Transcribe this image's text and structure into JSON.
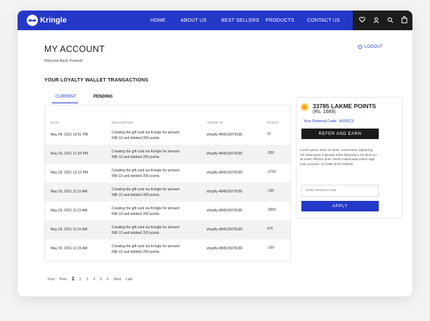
{
  "header": {
    "brand": "Kringle",
    "nav": [
      "HOME",
      "ABOUT US",
      "BEST SELLERS",
      "PRODUCTS",
      "CONTACT US"
    ],
    "icons": [
      "heart-icon",
      "user-icon",
      "search-icon",
      "bag-icon"
    ]
  },
  "account": {
    "title": "MY ACCOUNT",
    "welcome": "Welcome Back, Pramod!",
    "logout": "LOGOUT"
  },
  "wallet": {
    "section_title": "YOUR LOYALTY WALLET TRANSACTIONS",
    "tabs": [
      "CURRENT",
      "PENDING"
    ],
    "columns": [
      "DATE",
      "DESCRIPTION",
      "ORDER ID",
      "POINTS"
    ],
    "rows": [
      {
        "date": "May 04, 2021 16:51 PM",
        "desc1": "Creating the gift card via Kringle for amount",
        "desc2": "INR 10 and debited 200 points.",
        "order": "shopify-484615979180",
        "points": "10"
      },
      {
        "date": "May 03, 2021 21:29 PM",
        "desc1": "Creating the gift card via Kringle for amount",
        "desc2": "INR 10 and debited 200 points.",
        "order": "shopify-484615979180",
        "points": "-200"
      },
      {
        "date": "May 03, 2021 12:12 PM",
        "desc1": "Creating the gift card via Kringle for amount",
        "desc2": "INR 10 and debited 200 points.",
        "order": "shopify-484615979180",
        "points": "-1760"
      },
      {
        "date": "May 03, 2021 11:23 AM",
        "desc1": "Creating the gift card via Kringle for amount",
        "desc2": "INR 10 and debited 200 points.",
        "order": "shopify-484615979180",
        "points": "-100"
      },
      {
        "date": "May 03, 2021 11:23 AM",
        "desc1": "Creating the gift card via Kringle for amount",
        "desc2": "INR 10 and debited 200 points.",
        "order": "shopify-484615979180",
        "points": "-2000"
      },
      {
        "date": "May 03, 2021 11:15 AM",
        "desc1": "Creating the gift card via Kringle for amount",
        "desc2": "INR 10 and debited 200 points.",
        "order": "shopify-484615979180",
        "points": "475"
      },
      {
        "date": "May 03, 2021 11:15 AM",
        "desc1": "Creating the gift card via Kringle for amount",
        "desc2": "INR 10 and debited 200 points.",
        "order": "shopify-484615979180",
        "points": "-100"
      }
    ],
    "pagination": {
      "first": "First",
      "prev": "Prev",
      "pages": [
        "1",
        "2",
        "3",
        "4",
        "5",
        "6"
      ],
      "next": "Next",
      "last": "Last",
      "current": "1"
    }
  },
  "points_panel": {
    "points": "33785 LAKME POINTS",
    "amount": "(Rs. 1689)",
    "referral_code": "Your Referral Code : A182C3",
    "refer_button": "REFER AND EARN",
    "lorem": "Lorem ipsum dolor sit amet, consectetur adipiscing elit. Maecenas vulputate tellus bibendum, tincidunt mi sit amet, efficitur dolor. Morbi malesuada metus eget justo posuere, et mattis dolor facilisis.",
    "input_placeholder": "Enter Referral Code",
    "apply_button": "APPLY"
  },
  "colors": {
    "brand_blue": "#2438c8",
    "dark": "#1c1c1c",
    "accent_gold": "#f2a91a"
  }
}
